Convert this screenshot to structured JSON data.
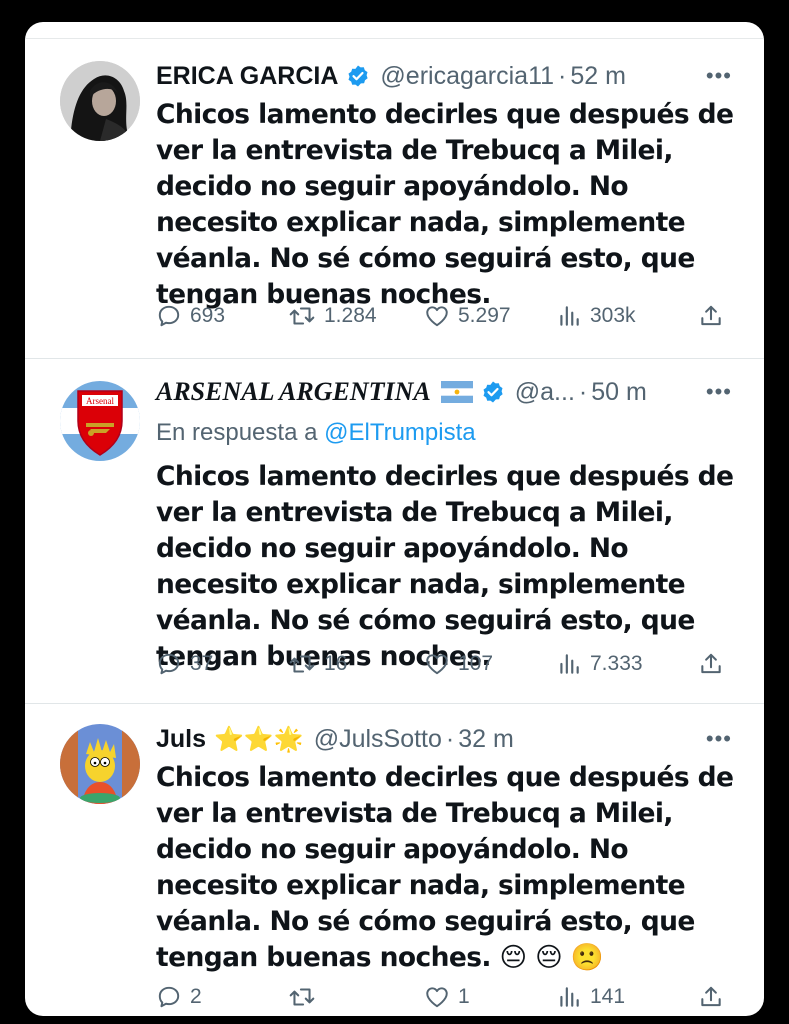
{
  "tweets": [
    {
      "name": "ERICA GARCIA",
      "handle": "@ericagarcia11",
      "time": "52 m",
      "text": "Chicos lamento decirles que después de ver la entrevista de Trebucq a Milei, decido no seguir apoyándolo. No necesito explicar nada, simplemente véanla. No sé cómo seguirá esto, que tengan buenas noches.",
      "replies": "693",
      "retweets": "1.284",
      "likes": "5.297",
      "views": "303k"
    },
    {
      "name": "ARSENAL ARGENTINA",
      "handle": "@a...",
      "time": "50 m",
      "reply_prefix": "En respuesta a",
      "reply_to": "@ElTrumpista",
      "avatar_text": "Arsenal",
      "text": "Chicos lamento decirles que después de ver la entrevista de Trebucq a Milei, decido no seguir apoyándolo. No necesito explicar nada, simplemente véanla. No sé cómo seguirá esto, que tengan buenas noches.",
      "replies": "37",
      "retweets": "16",
      "likes": "107",
      "views": "7.333"
    },
    {
      "name": "Juls",
      "name_emoji": "⭐⭐🌟",
      "handle": "@JulsSotto",
      "time": "32 m",
      "text": "Chicos lamento decirles que después de ver la entrevista de Trebucq a Milei, decido no seguir apoyándolo. No necesito explicar nada, simplemente véanla. No sé cómo seguirá esto, que tengan buenas noches.",
      "text_emoji": "😔 😔 🙁",
      "replies": "2",
      "retweets": "",
      "likes": "1",
      "views": "141"
    }
  ],
  "colors": {
    "secondary": "#536471",
    "link": "#1d9bf0",
    "verified": "#1d9bf0",
    "text": "#0f1419"
  },
  "icons": [
    "reply-icon",
    "retweet-icon",
    "like-icon",
    "views-icon",
    "share-icon",
    "more-icon",
    "verified-icon",
    "argentina-flag-icon"
  ]
}
